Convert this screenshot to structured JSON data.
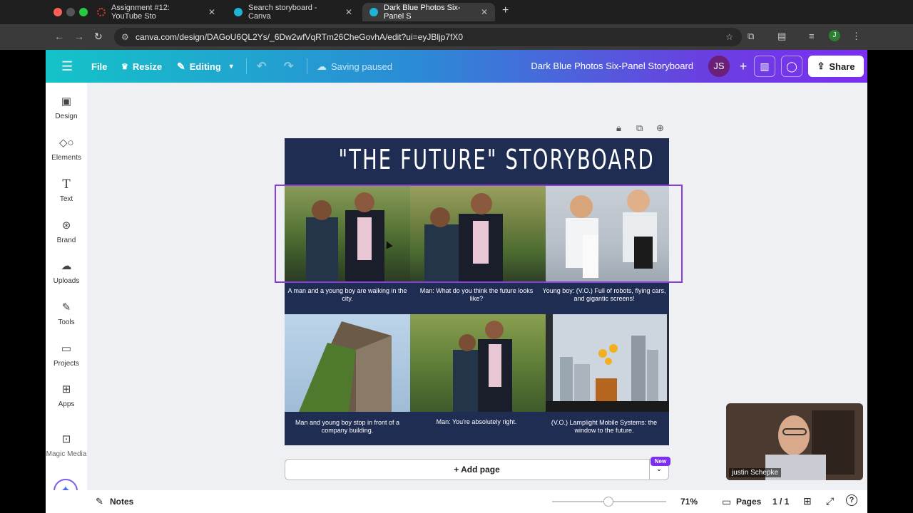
{
  "browser": {
    "tabs": [
      {
        "label": "Assignment #12: YouTube Sto",
        "active": false
      },
      {
        "label": "Search storyboard - Canva",
        "active": false
      },
      {
        "label": "Dark Blue Photos Six-Panel S",
        "active": true
      }
    ],
    "url": "canva.com/design/DAGoU6QL2Ys/_6Dw2wfVqRTm26CheGovhA/edit?ui=eyJBljp7fX0",
    "profile_initial": "J"
  },
  "header": {
    "file_label": "File",
    "resize_label": "Resize",
    "editing_label": "Editing",
    "saving_status": "Saving paused",
    "doc_title": "Dark Blue Photos Six-Panel Storyboard",
    "avatar_initials": "JS",
    "share_label": "Share"
  },
  "sidebar": {
    "items": [
      {
        "label": "Design",
        "icon": "design-icon"
      },
      {
        "label": "Elements",
        "icon": "elements-icon"
      },
      {
        "label": "Text",
        "icon": "text-icon"
      },
      {
        "label": "Brand",
        "icon": "brand-icon"
      },
      {
        "label": "Uploads",
        "icon": "uploads-icon"
      },
      {
        "label": "Tools",
        "icon": "tools-icon"
      },
      {
        "label": "Projects",
        "icon": "projects-icon"
      },
      {
        "label": "Apps",
        "icon": "apps-icon"
      },
      {
        "label": "Magic Media",
        "icon": "magic-media-icon"
      }
    ]
  },
  "design": {
    "title": "\"THE FUTURE\" STORYBOARD",
    "captions": [
      "A man and a young boy are walking in the city.",
      "Man: What do you think the future looks like?",
      "Young boy: (V.O.) Full of robots, flying cars, and gigantic screens!",
      "Man and young boy stop in front of a company building.",
      "Man: You're absolutely right.",
      "(V.O.) Lamplight Mobile Systems: the window to the future."
    ],
    "bg_color": "#1f2d52"
  },
  "footer": {
    "add_page_label": "+ Add page",
    "new_badge": "New",
    "notes_label": "Notes",
    "zoom": "71%",
    "pages_label": "Pages",
    "page_count": "1 / 1"
  },
  "webcam": {
    "name": "justin Schepke"
  }
}
